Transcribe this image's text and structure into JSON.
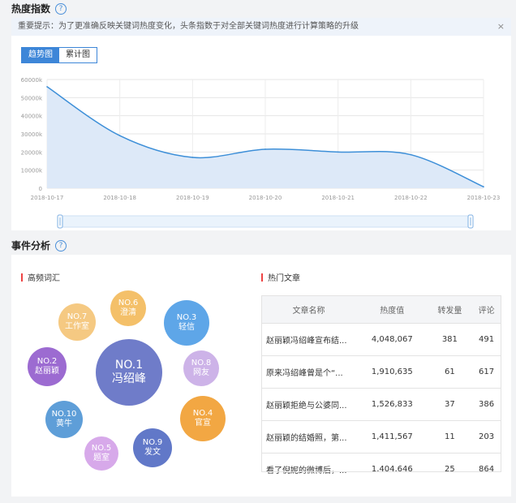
{
  "heat_index": {
    "title": "热度指数",
    "notice": "重要提示：为了更准确反映关键词热度变化，头条指数于对全部关键词热度进行计算策略的升级",
    "close": "×",
    "tabs": [
      "趋势图",
      "累计图"
    ],
    "active_tab": 0
  },
  "chart_data": {
    "type": "area",
    "x": [
      "2018-10-17",
      "2018-10-18",
      "2018-10-19",
      "2018-10-20",
      "2018-10-21",
      "2018-10-22",
      "2018-10-23"
    ],
    "values": [
      56000,
      29000,
      17000,
      21500,
      20000,
      18500,
      800
    ],
    "yticks": [
      "60000k",
      "50000k",
      "40000k",
      "30000k",
      "20000k",
      "10000k",
      "0"
    ],
    "ylim": [
      0,
      60000
    ],
    "grid": true,
    "line_color": "#3d8fd8",
    "fill_color": "#dde9f8"
  },
  "events": {
    "title": "事件分析",
    "words_title": "高频词汇",
    "articles_title": "热门文章",
    "bubbles": [
      {
        "no": "NO.1",
        "word": "冯绍峰",
        "color": "#6f7cc9"
      },
      {
        "no": "NO.2",
        "word": "赵丽颖",
        "color": "#9c6bd1"
      },
      {
        "no": "NO.3",
        "word": "轻信",
        "color": "#5ea6e8"
      },
      {
        "no": "NO.4",
        "word": "官宣",
        "color": "#f2a743"
      },
      {
        "no": "NO.5",
        "word": "题室",
        "color": "#d7a9ea"
      },
      {
        "no": "NO.6",
        "word": "澄清",
        "color": "#f4c069"
      },
      {
        "no": "NO.7",
        "word": "工作室",
        "color": "#f5c982"
      },
      {
        "no": "NO.8",
        "word": "网友",
        "color": "#cdb3e8"
      },
      {
        "no": "NO.9",
        "word": "发文",
        "color": "#6178c8"
      },
      {
        "no": "NO.10",
        "word": "黄牛",
        "color": "#5e9ed8"
      }
    ],
    "table": {
      "headers": [
        "文章名称",
        "热度值",
        "转发量",
        "评论"
      ],
      "rows": [
        [
          "赵丽颖冯绍峰宣布结...",
          "4,048,067",
          "381",
          "491"
        ],
        [
          "原来冯绍峰曾是个“...",
          "1,910,635",
          "61",
          "617"
        ],
        [
          "赵丽颖拒绝与公婆同...",
          "1,526,833",
          "37",
          "386"
        ],
        [
          "赵丽颖的结婚照，第...",
          "1,411,567",
          "11",
          "203"
        ],
        [
          "看了倪妮的微博后，...",
          "1,404,646",
          "25",
          "864"
        ]
      ]
    }
  }
}
